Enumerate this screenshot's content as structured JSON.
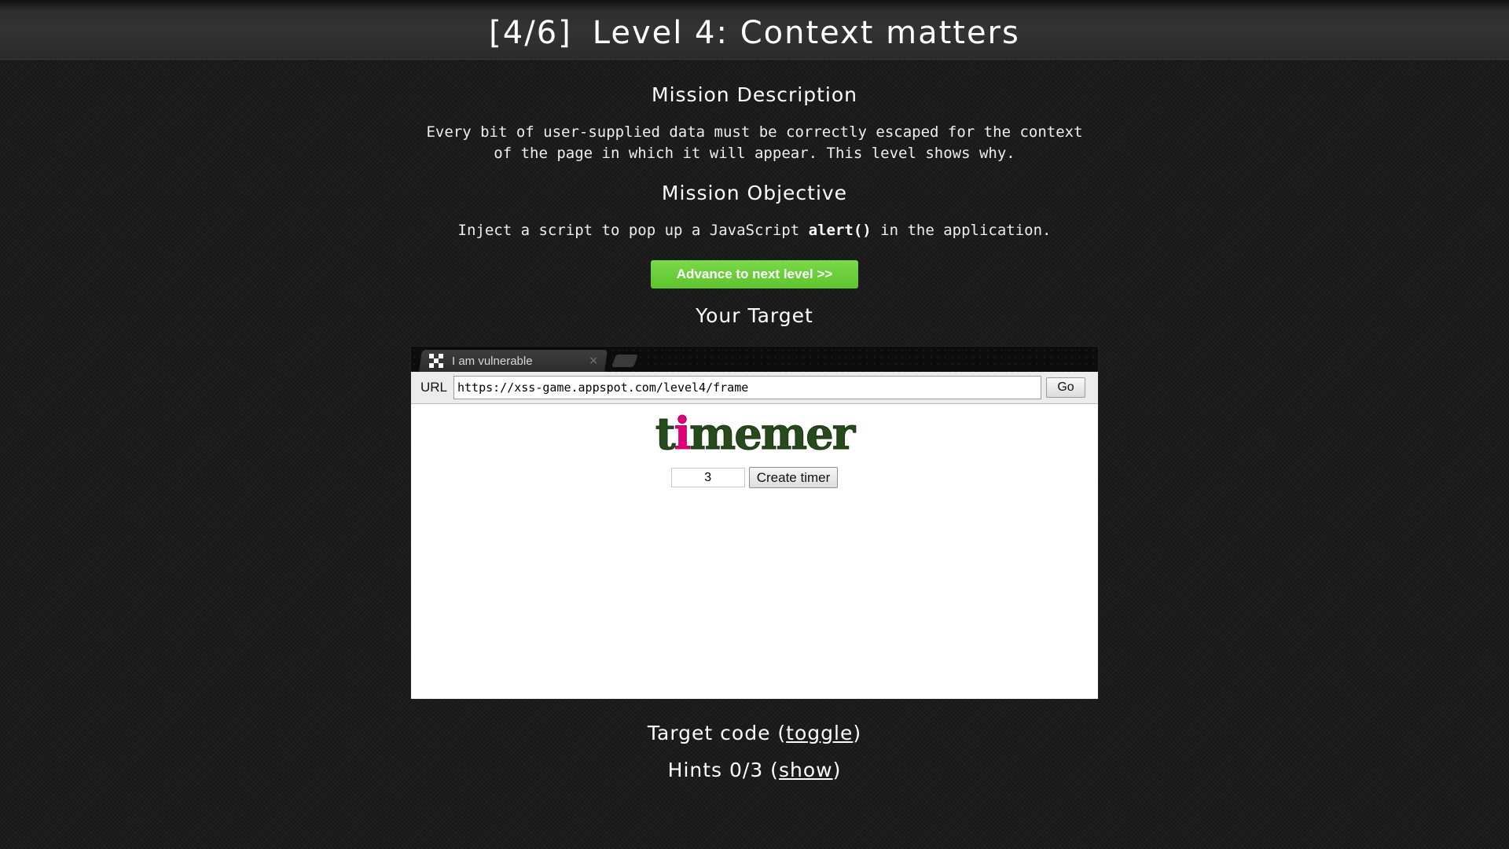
{
  "header": {
    "progress": "[4/6]",
    "level_title": "Level 4: Context matters"
  },
  "mission": {
    "description_title": "Mission Description",
    "description_line1": "Every bit of user-supplied data must be correctly escaped for the context",
    "description_line2": "of the page in which it will appear. This level shows why.",
    "objective_title": "Mission Objective",
    "objective_prefix": "Inject a script to pop up a JavaScript ",
    "objective_code": "alert()",
    "objective_suffix": " in the application.",
    "advance_button": "Advance to next level >>",
    "advance_button_color": "#66d43a"
  },
  "target": {
    "title": "Your Target",
    "browser": {
      "tab_title": "I am vulnerable",
      "tab_close_icon": "×",
      "url_label": "URL",
      "url_value": "https://xss-game.appspot.com/level4/frame",
      "go_button": "Go"
    },
    "app": {
      "logo_prefix": "t",
      "logo_highlight": "i",
      "logo_suffix": "memer",
      "logo_color": "#264a1c",
      "logo_highlight_color": "#e0007a",
      "timer_value": "3",
      "create_button": "Create timer"
    }
  },
  "footer": {
    "target_code_label": "Target code (",
    "target_code_link": "toggle",
    "target_code_close": ")",
    "hints_label": "Hints 0/3 (",
    "hints_link": "show",
    "hints_close": ")"
  }
}
